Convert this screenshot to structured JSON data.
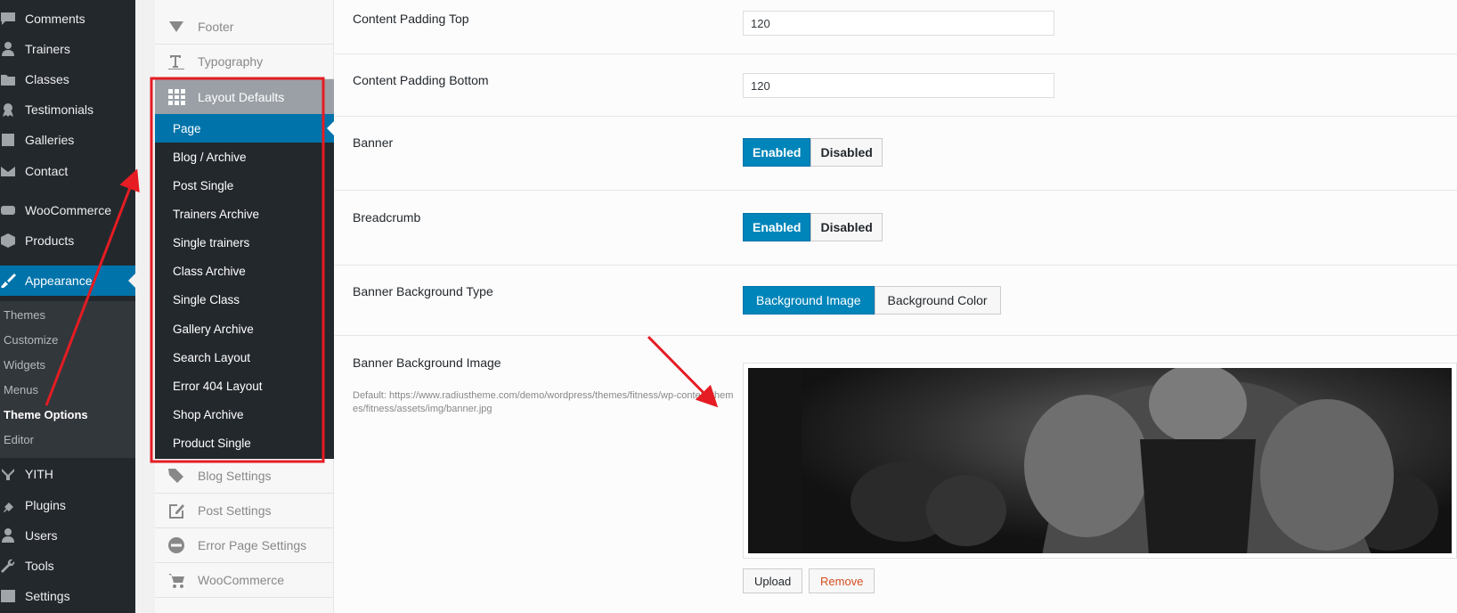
{
  "wp_menu": {
    "items": [
      {
        "label": "Comments",
        "icon": "comment-icon"
      },
      {
        "label": "Trainers",
        "icon": "user-icon"
      },
      {
        "label": "Classes",
        "icon": "folder-icon"
      },
      {
        "label": "Testimonials",
        "icon": "award-icon"
      },
      {
        "label": "Galleries",
        "icon": "gallery-icon"
      },
      {
        "label": "Contact",
        "icon": "mail-icon"
      },
      {
        "label": "WooCommerce",
        "icon": "woo-icon"
      },
      {
        "label": "Products",
        "icon": "box-icon"
      },
      {
        "label": "Appearance",
        "icon": "brush-icon"
      }
    ],
    "appearance_sub": [
      "Themes",
      "Customize",
      "Widgets",
      "Menus",
      "Theme Options",
      "Editor"
    ],
    "bottom_items": [
      {
        "label": "YITH",
        "icon": "yith-icon"
      },
      {
        "label": "Plugins",
        "icon": "plugin-icon"
      },
      {
        "label": "Users",
        "icon": "users-icon"
      },
      {
        "label": "Tools",
        "icon": "wrench-icon"
      },
      {
        "label": "Settings",
        "icon": "settings-icon"
      }
    ]
  },
  "options_sidebar": {
    "top_items": [
      {
        "label": "Footer",
        "icon": "triangle-down-icon"
      },
      {
        "label": "Typography",
        "icon": "text-icon"
      }
    ],
    "active_section": {
      "label": "Layout Defaults",
      "icon": "grid-icon"
    },
    "sub_items": [
      "Page",
      "Blog / Archive",
      "Post Single",
      "Trainers Archive",
      "Single trainers",
      "Class Archive",
      "Single Class",
      "Gallery Archive",
      "Search Layout",
      "Error 404 Layout",
      "Shop Archive",
      "Product Single"
    ],
    "bottom_items": [
      {
        "label": "Blog Settings",
        "icon": "tags-icon"
      },
      {
        "label": "Post Settings",
        "icon": "edit-icon"
      },
      {
        "label": "Error Page Settings",
        "icon": "minus-circle-icon"
      },
      {
        "label": "WooCommerce",
        "icon": "cart-icon"
      }
    ]
  },
  "fields": {
    "padding_top": {
      "label": "Content Padding Top",
      "value": "120"
    },
    "padding_bottom": {
      "label": "Content Padding Bottom",
      "value": "120"
    },
    "banner": {
      "label": "Banner",
      "on": "Enabled",
      "off": "Disabled"
    },
    "breadcrumb": {
      "label": "Breadcrumb",
      "on": "Enabled",
      "off": "Disabled"
    },
    "banner_bg_type": {
      "label": "Banner Background Type",
      "opt1": "Background Image",
      "opt2": "Background Color"
    },
    "banner_bg_image": {
      "label": "Banner Background Image",
      "desc": "Default: https://www.radiustheme.com/demo/wordpress/themes/fitness/wp-content/themes/fitness/assets/img/banner.jpg",
      "upload": "Upload",
      "remove": "Remove"
    }
  },
  "colors": {
    "admin_bg": "#23282d",
    "accent": "#0073aa",
    "annotation": "#e51c23"
  }
}
